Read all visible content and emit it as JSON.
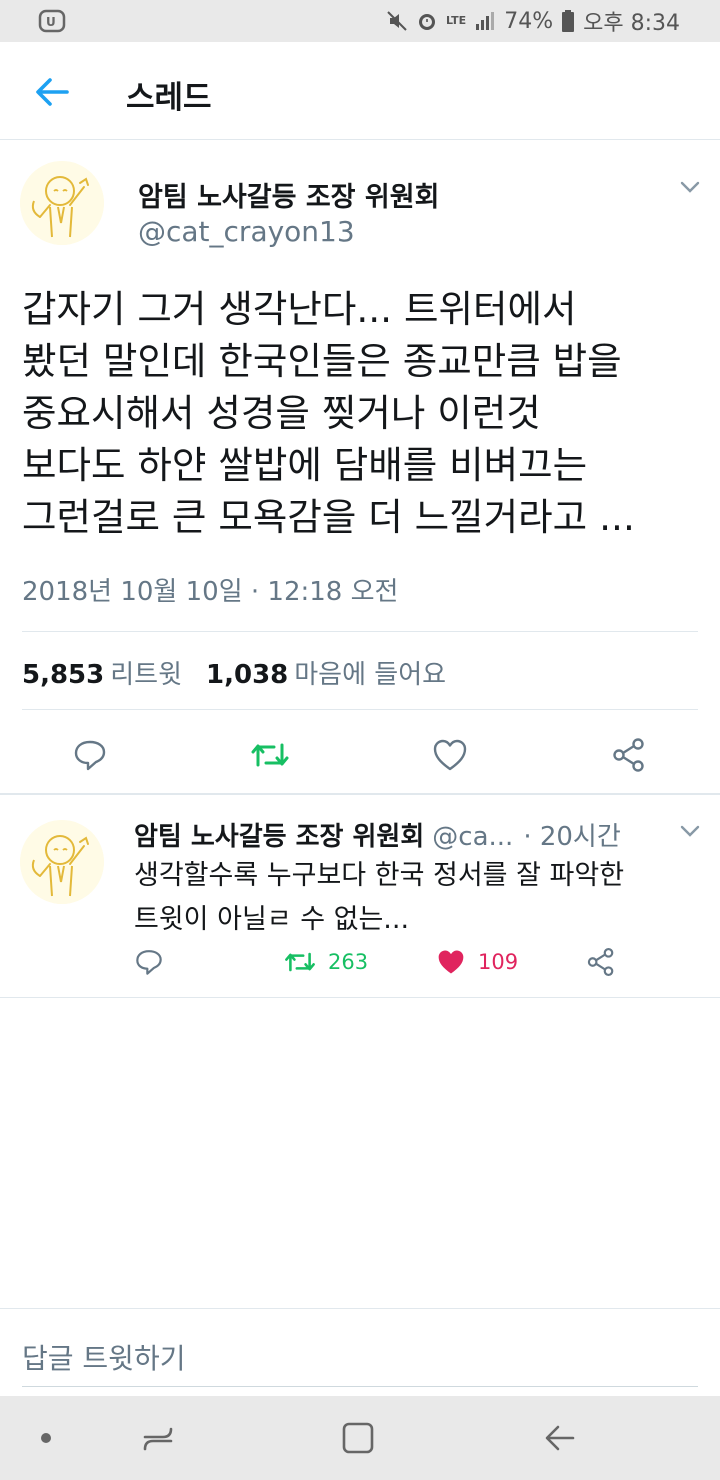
{
  "status_bar": {
    "battery": "74%",
    "time": "오후 8:34",
    "network": "LTE"
  },
  "header": {
    "title": "스레드"
  },
  "main_tweet": {
    "author_name": "암팀 노사갈등 조장 위원회",
    "author_handle": "@cat_crayon13",
    "text": "갑자기 그거 생각난다... 트위터에서\n봤던 말인데 한국인들은 종교만큼 밥을\n중요시해서 성경을 찢거나 이런것\n보다도 하얀 쌀밥에 담배를 비벼끄는\n그런걸로 큰 모욕감을 더 느낄거라고 ...",
    "timestamp": "2018년 10월 10일 · 12:18 오전",
    "retweets": "5,853",
    "retweets_label": "리트윗",
    "likes": "1,038",
    "likes_label": "마음에 들어요"
  },
  "reply_tweet": {
    "author_name": "암팀 노사갈등 조장 위원회",
    "author_handle": "@ca...",
    "time": "· 20시간",
    "text": "생각할수록 누구보다 한국 정서를 잘 파악한\n트윗이 아닐ㄹ 수 없는...",
    "retweets": "263",
    "likes": "109"
  },
  "composer": {
    "placeholder": "답글 트윗하기"
  },
  "colors": {
    "accent": "#1da1f2",
    "retweet": "#17bf63",
    "like": "#e0245e",
    "muted": "#657786"
  }
}
